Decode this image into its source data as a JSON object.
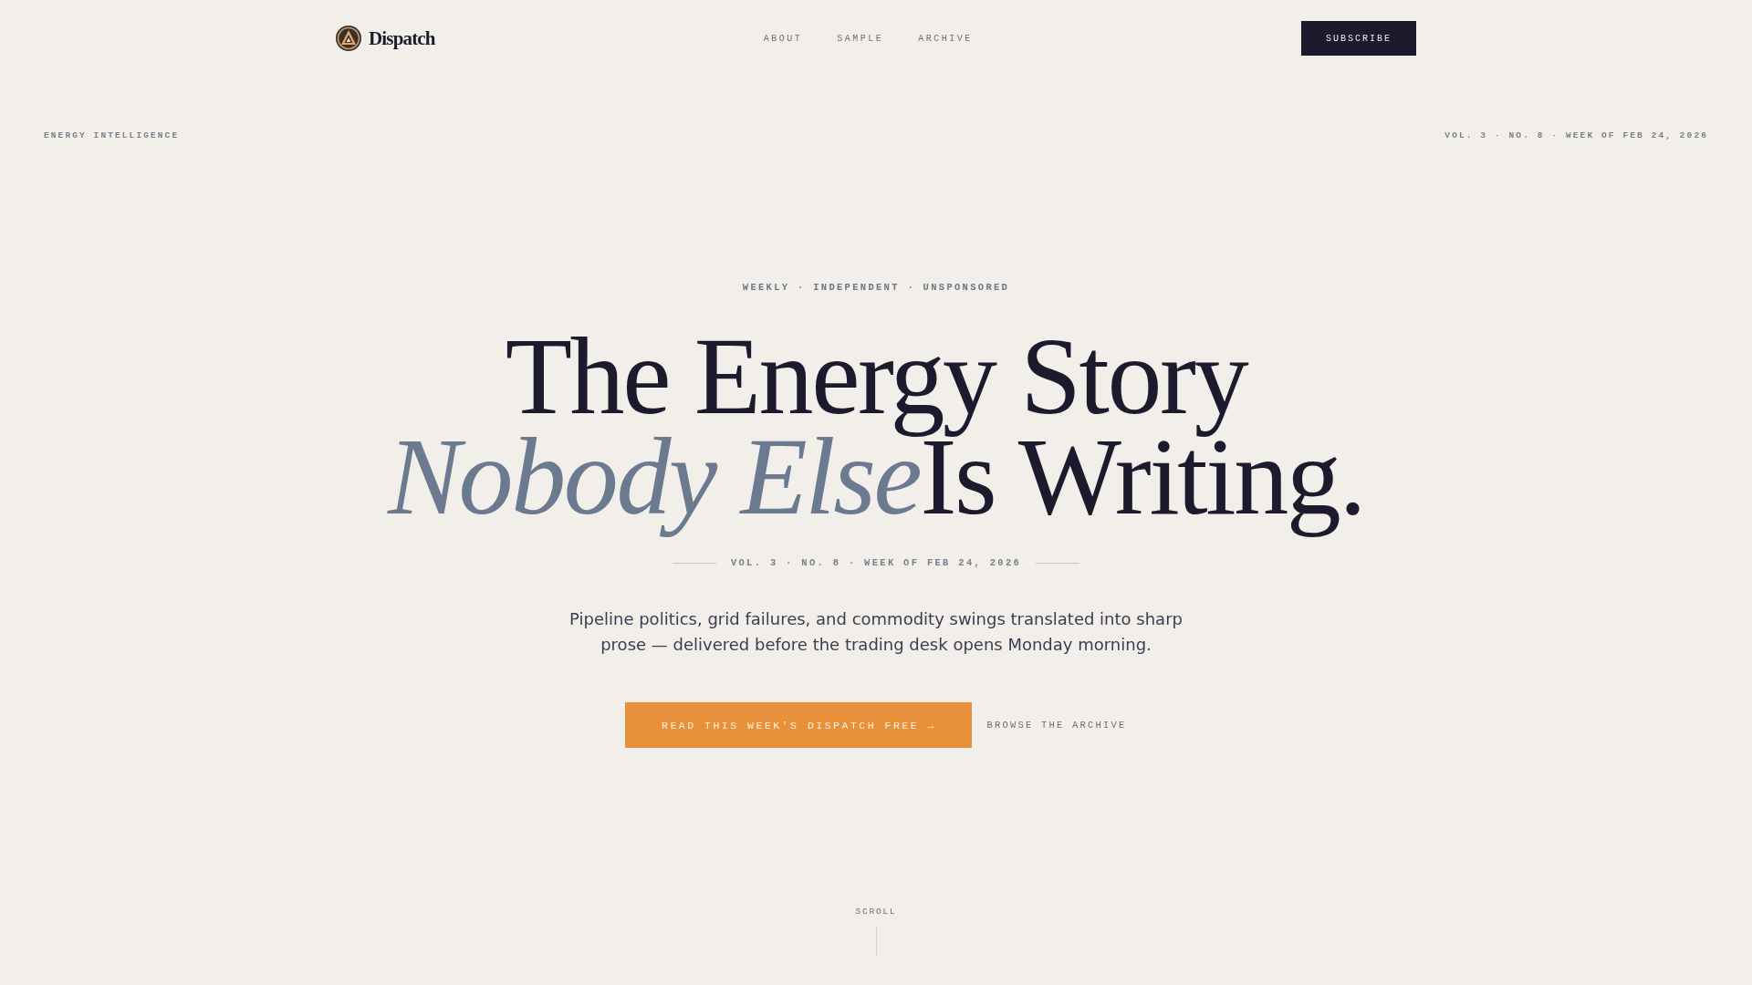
{
  "header": {
    "brand": "Dispatch",
    "nav": [
      "ABOUT",
      "SAMPLE",
      "ARCHIVE"
    ],
    "subscribe_button": "SUBSCRIBE"
  },
  "top_bar": {
    "section": "ENERGY INTELLIGENCE",
    "issue": "VOL. 3 · NO. 8 · WEEK OF FEB 24, 2026"
  },
  "hero": {
    "eyebrow": "WEEKLY · INDEPENDENT · UNSPONSORED",
    "headline": [
      [
        {
          "text": "The Energy Story",
          "kind": "plain"
        }
      ],
      [
        {
          "text": "Nobody Else",
          "kind": "accent"
        },
        {
          "text": "Is Writing.",
          "kind": "plain"
        }
      ]
    ],
    "issue_line": "VOL. 3 · NO. 8 · WEEK OF FEB 24, 2026",
    "description": "Pipeline politics, grid failures, and commodity swings translated into sharp prose — delivered before the trading desk opens Monday morning.",
    "primary_button": "READ THIS WEEK'S DISPATCH FREE →",
    "secondary_link": "BROWSE THE ARCHIVE"
  },
  "scroll_hint": "SCROLL"
}
